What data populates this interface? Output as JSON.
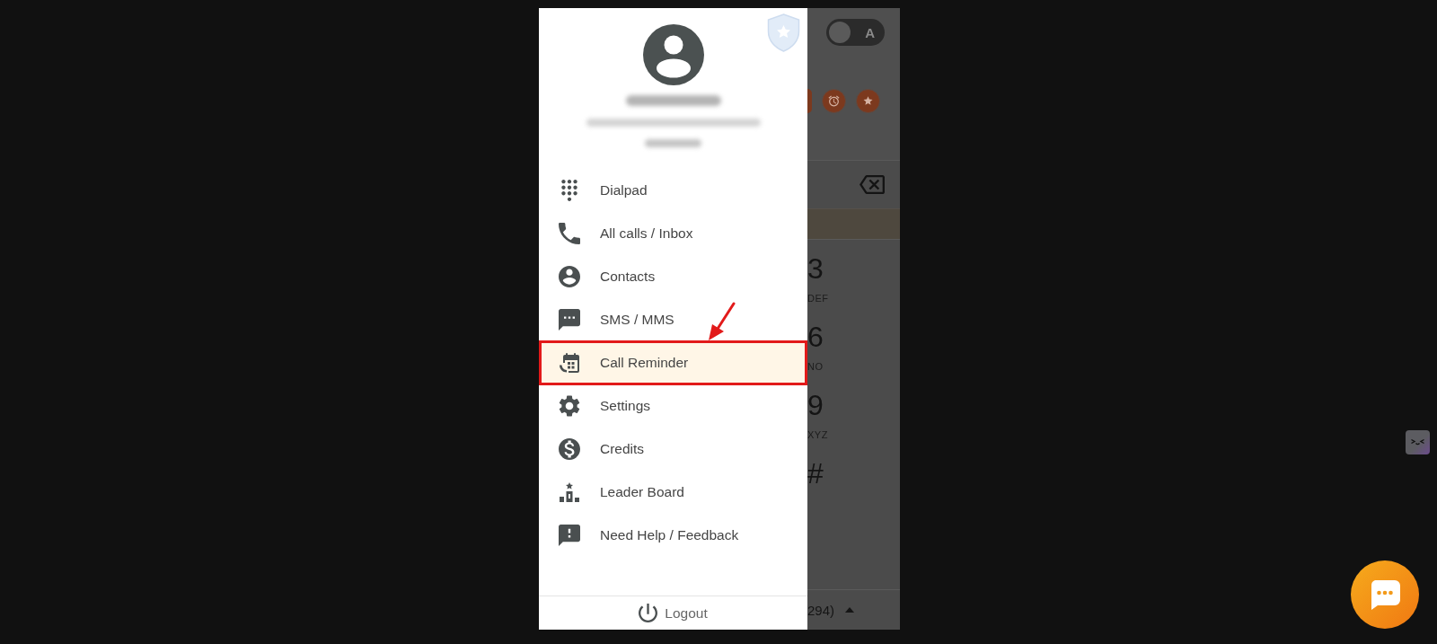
{
  "drawer": {
    "menu": [
      {
        "label": "Dialpad",
        "selected": false,
        "highlighted": false
      },
      {
        "label": "All calls / Inbox",
        "selected": false,
        "highlighted": false
      },
      {
        "label": "Contacts",
        "selected": false,
        "highlighted": false
      },
      {
        "label": "SMS / MMS",
        "selected": false,
        "highlighted": false
      },
      {
        "label": "Call Reminder",
        "selected": true,
        "highlighted": true
      },
      {
        "label": "Settings",
        "selected": false,
        "highlighted": false
      },
      {
        "label": "Credits",
        "selected": false,
        "highlighted": false
      },
      {
        "label": "Leader Board",
        "selected": false,
        "highlighted": false
      },
      {
        "label": "Need Help / Feedback",
        "selected": false,
        "highlighted": false
      }
    ],
    "logout": {
      "label": "Logout"
    }
  },
  "background_app": {
    "theme_toggle": {
      "label": "A",
      "on": false
    },
    "keypad": [
      {
        "digit": "3",
        "letters": "DEF"
      },
      {
        "digit": "6",
        "letters": "NO"
      },
      {
        "digit": "9",
        "letters": "XYZ"
      },
      {
        "digit": "#"
      }
    ],
    "footer": {
      "text": "294)"
    }
  }
}
